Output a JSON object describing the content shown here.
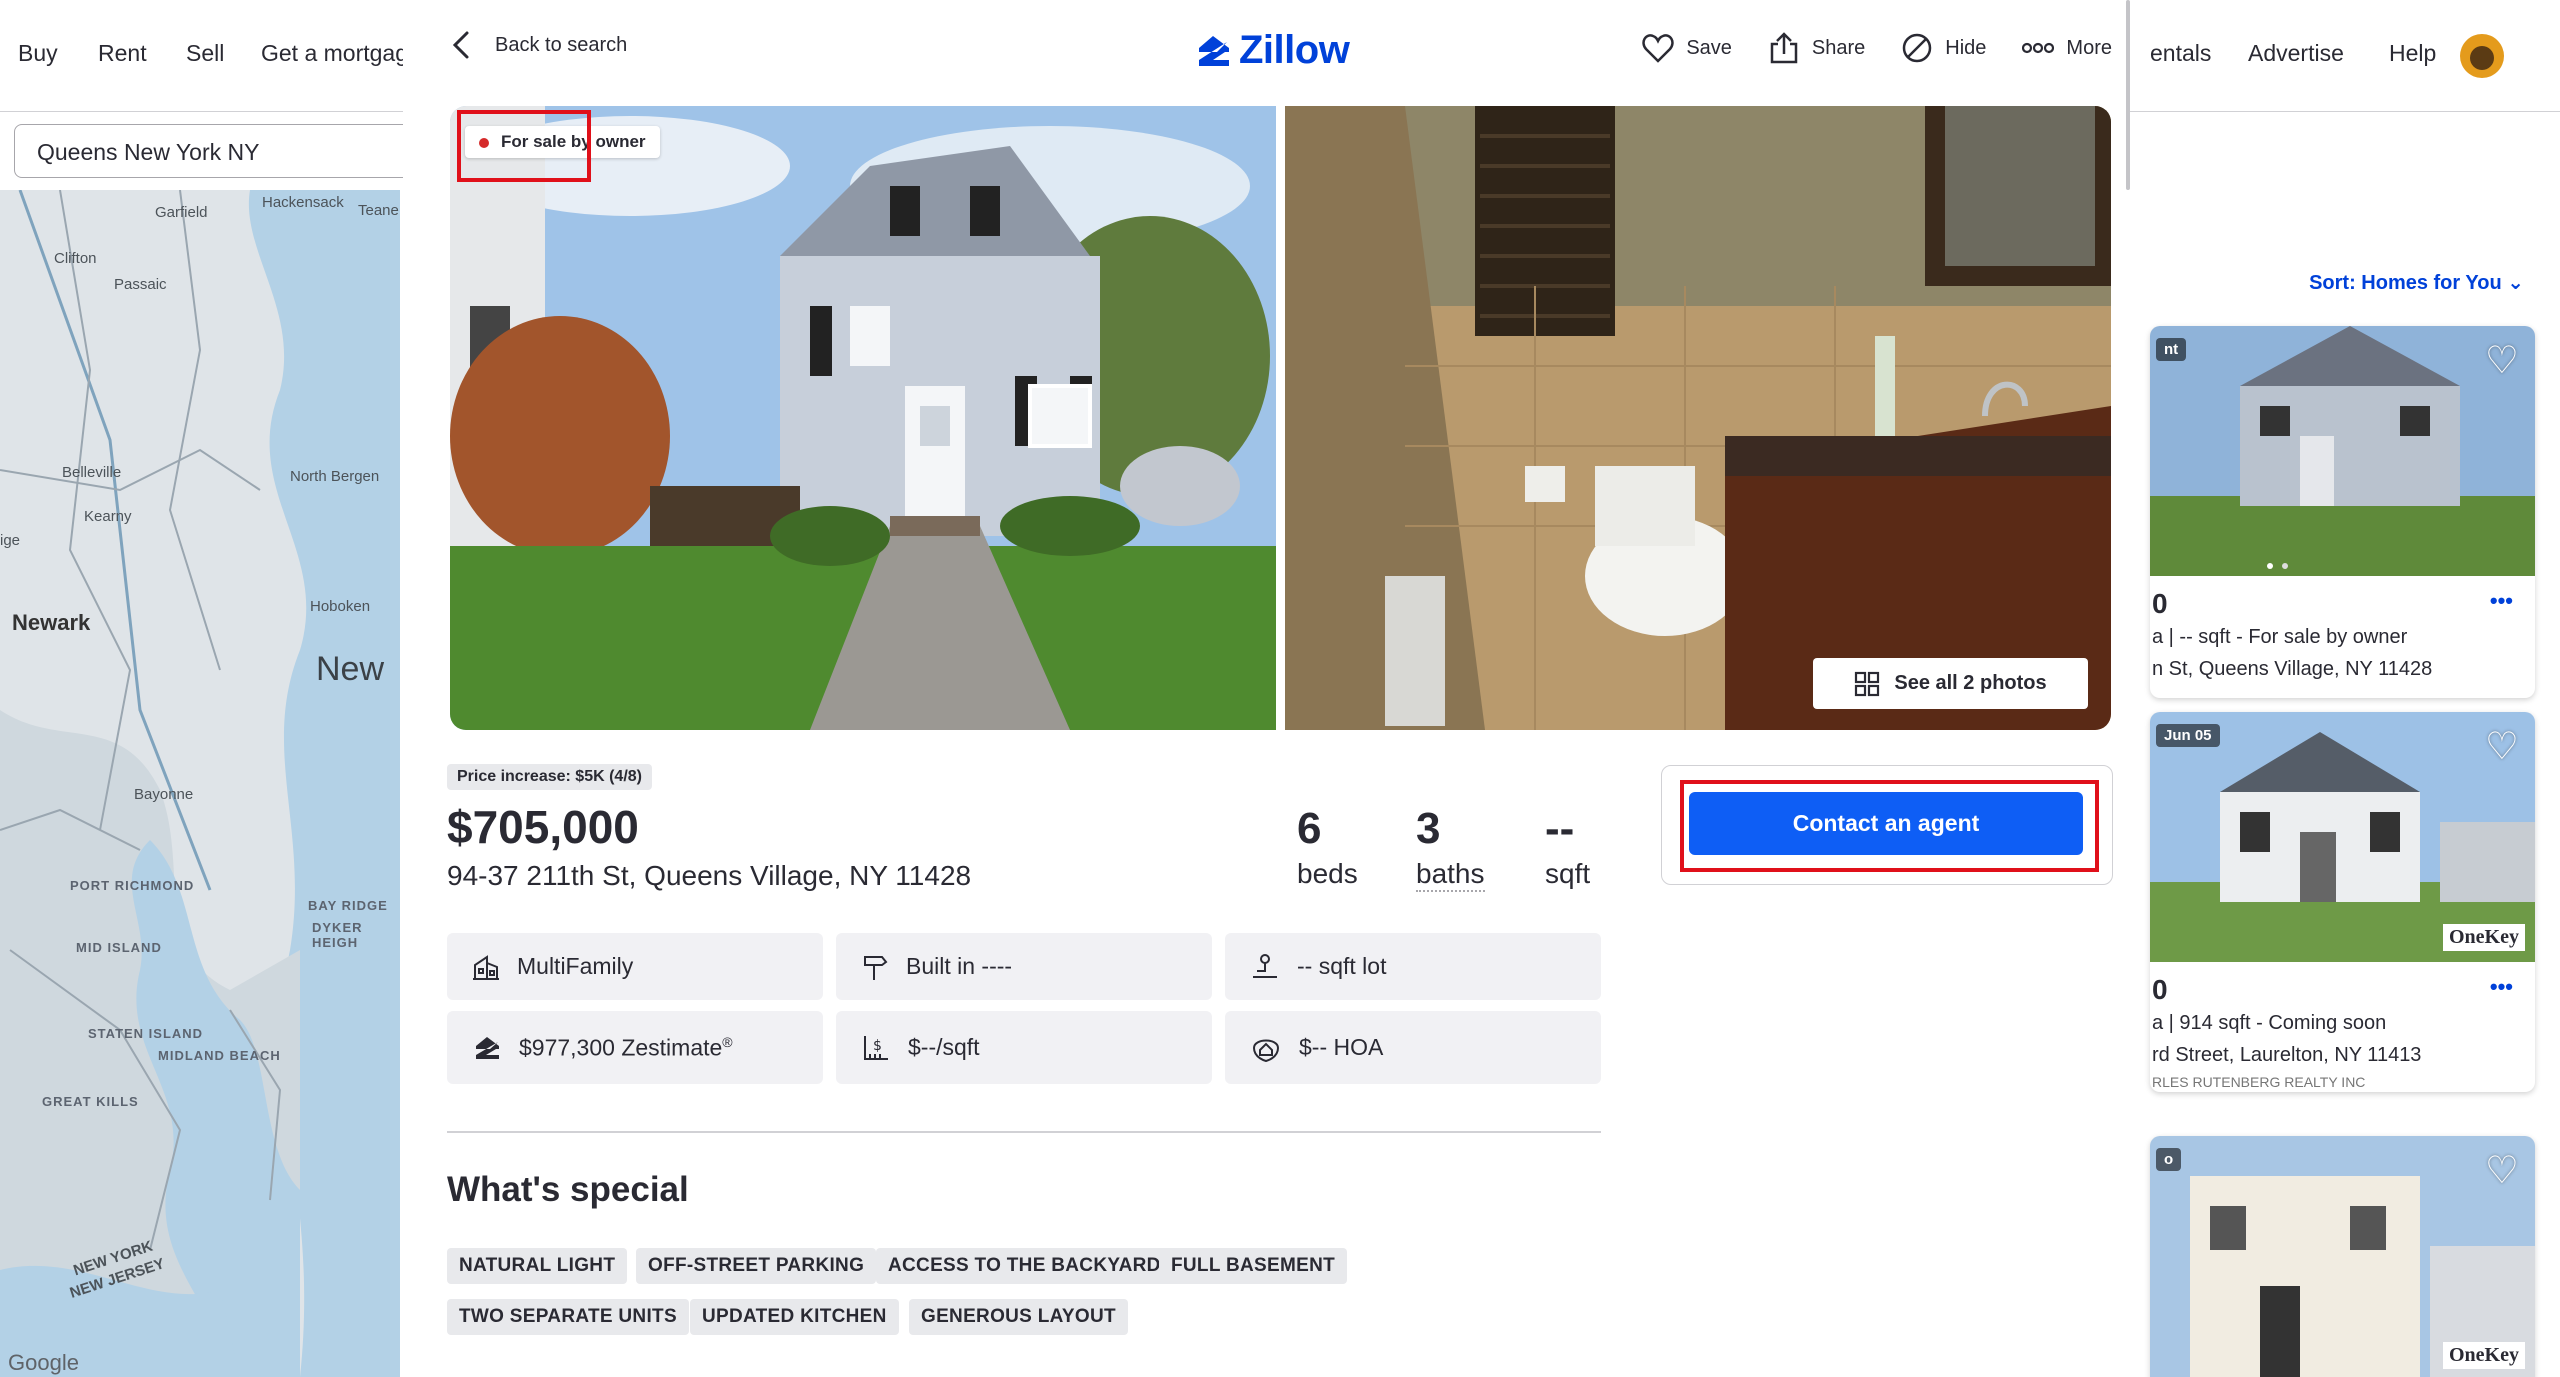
{
  "background": {
    "nav": [
      "Buy",
      "Rent",
      "Sell",
      "Get a mortgag",
      "entals",
      "Advertise",
      "Help"
    ],
    "search_value": "Queens New York NY",
    "map_labels": [
      "Hackensack",
      "Teane",
      "Garfield",
      "Clifton",
      "Passaic",
      "Belleville",
      "North Bergen",
      "Kearny",
      "ige",
      "Newark",
      "Hoboken",
      "New",
      "Bayonne",
      "PORT RICHMOND",
      "BAY RIDGE",
      "DYKER HEIGH",
      "MID ISLAND",
      "STATEN ISLAND",
      "MIDLAND BEACH",
      "GREAT KILLS",
      "NEW YORK",
      "NEW JERSEY",
      "Google"
    ],
    "sort_label": "Sort: Homes for You",
    "cards": [
      {
        "price": "0",
        "line1": "a | -- sqft - For sale by owner",
        "line2": "n St, Queens Village, NY 11428",
        "line3": "",
        "tag": "nt"
      },
      {
        "price": "0",
        "line1": "a | 914 sqft - Coming soon",
        "line2": "rd Street, Laurelton, NY 11413",
        "line3": "RLES RUTENBERG REALTY INC",
        "tag": "Jun 05",
        "brand": "OneKey"
      },
      {
        "price": "",
        "line1": "",
        "line2": "",
        "line3": "",
        "tag": "o",
        "brand": "OneKey"
      }
    ]
  },
  "header": {
    "back_label": "Back to search",
    "logo_text": "Zillow",
    "actions": {
      "save": "Save",
      "share": "Share",
      "hide": "Hide",
      "more": "More"
    }
  },
  "photos": {
    "badge": "For sale by owner",
    "see_all": "See all 2 photos"
  },
  "listing": {
    "price_change": "Price increase: $5K (4/8)",
    "price": "$705,000",
    "address": "94-37 211th St, Queens Village, NY 11428",
    "beds": {
      "value": "6",
      "label": "beds"
    },
    "baths": {
      "value": "3",
      "label": "baths"
    },
    "sqft": {
      "value": "--",
      "label": "sqft"
    }
  },
  "contact_button": "Contact an agent",
  "facts": {
    "type": "MultiFamily",
    "built": "Built in ----",
    "lot": "-- sqft lot",
    "zestimate": "$977,300 Zestimate",
    "zestimate_mark": "®",
    "price_sqft": "$--/sqft",
    "hoa": "$-- HOA"
  },
  "special": {
    "title": "What's special",
    "tags": [
      "NATURAL LIGHT",
      "OFF-STREET PARKING",
      "ACCESS TO THE BACKYARD",
      "FULL BASEMENT",
      "TWO SEPARATE UNITS",
      "UPDATED KITCHEN",
      "GENEROUS LAYOUT"
    ]
  },
  "colors": {
    "brand_blue": "#0041d9",
    "button_blue": "#0e5ef5",
    "highlight_red": "#e0101a"
  }
}
